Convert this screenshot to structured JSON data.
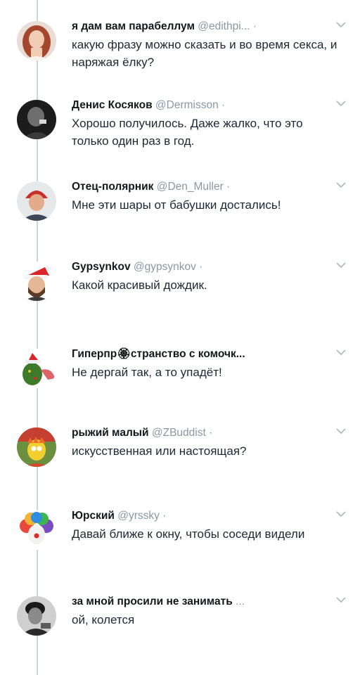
{
  "tweets": [
    {
      "name": "я дам вам парабеллум",
      "handle": "@edithpi...",
      "sep": "·",
      "text": "какую фразу можно сказать и во время секса, и наряжая ёлку?"
    },
    {
      "name": "Денис Косяков",
      "handle": "@Dermisson",
      "sep": "·",
      "text": "Хорошо получилось. Даже жалко, что это только один раз в год."
    },
    {
      "name": "Отец-полярник",
      "handle": "@Den_Muller",
      "sep": "·",
      "text": "Мне эти шары от бабушки достались!"
    },
    {
      "name": "Gypsynkov",
      "handle": "@gypsynkov",
      "sep": "·",
      "text": "Какой красивый дождик."
    },
    {
      "name": "Гиперпр🏵странство с комочк...",
      "handle": "",
      "sep": "",
      "text": "Не дергай так, а то упадёт!"
    },
    {
      "name": "рыжий малый",
      "handle": "@ZBuddist",
      "sep": "·",
      "text": "искусственная или настоящая?"
    },
    {
      "name": "Юрский",
      "handle": "@yrssky",
      "sep": "·",
      "text": "Давай ближе к окну, чтобы соседи видели"
    },
    {
      "name": "за мной просили не занимать",
      "handle": "...",
      "sep": "",
      "text": "ой, колется"
    }
  ],
  "icons": {
    "more": "chevron-down-icon"
  },
  "colors": {
    "thread_line": "#ccd6dd",
    "handle": "#8a97a3",
    "text": "#14171a"
  }
}
